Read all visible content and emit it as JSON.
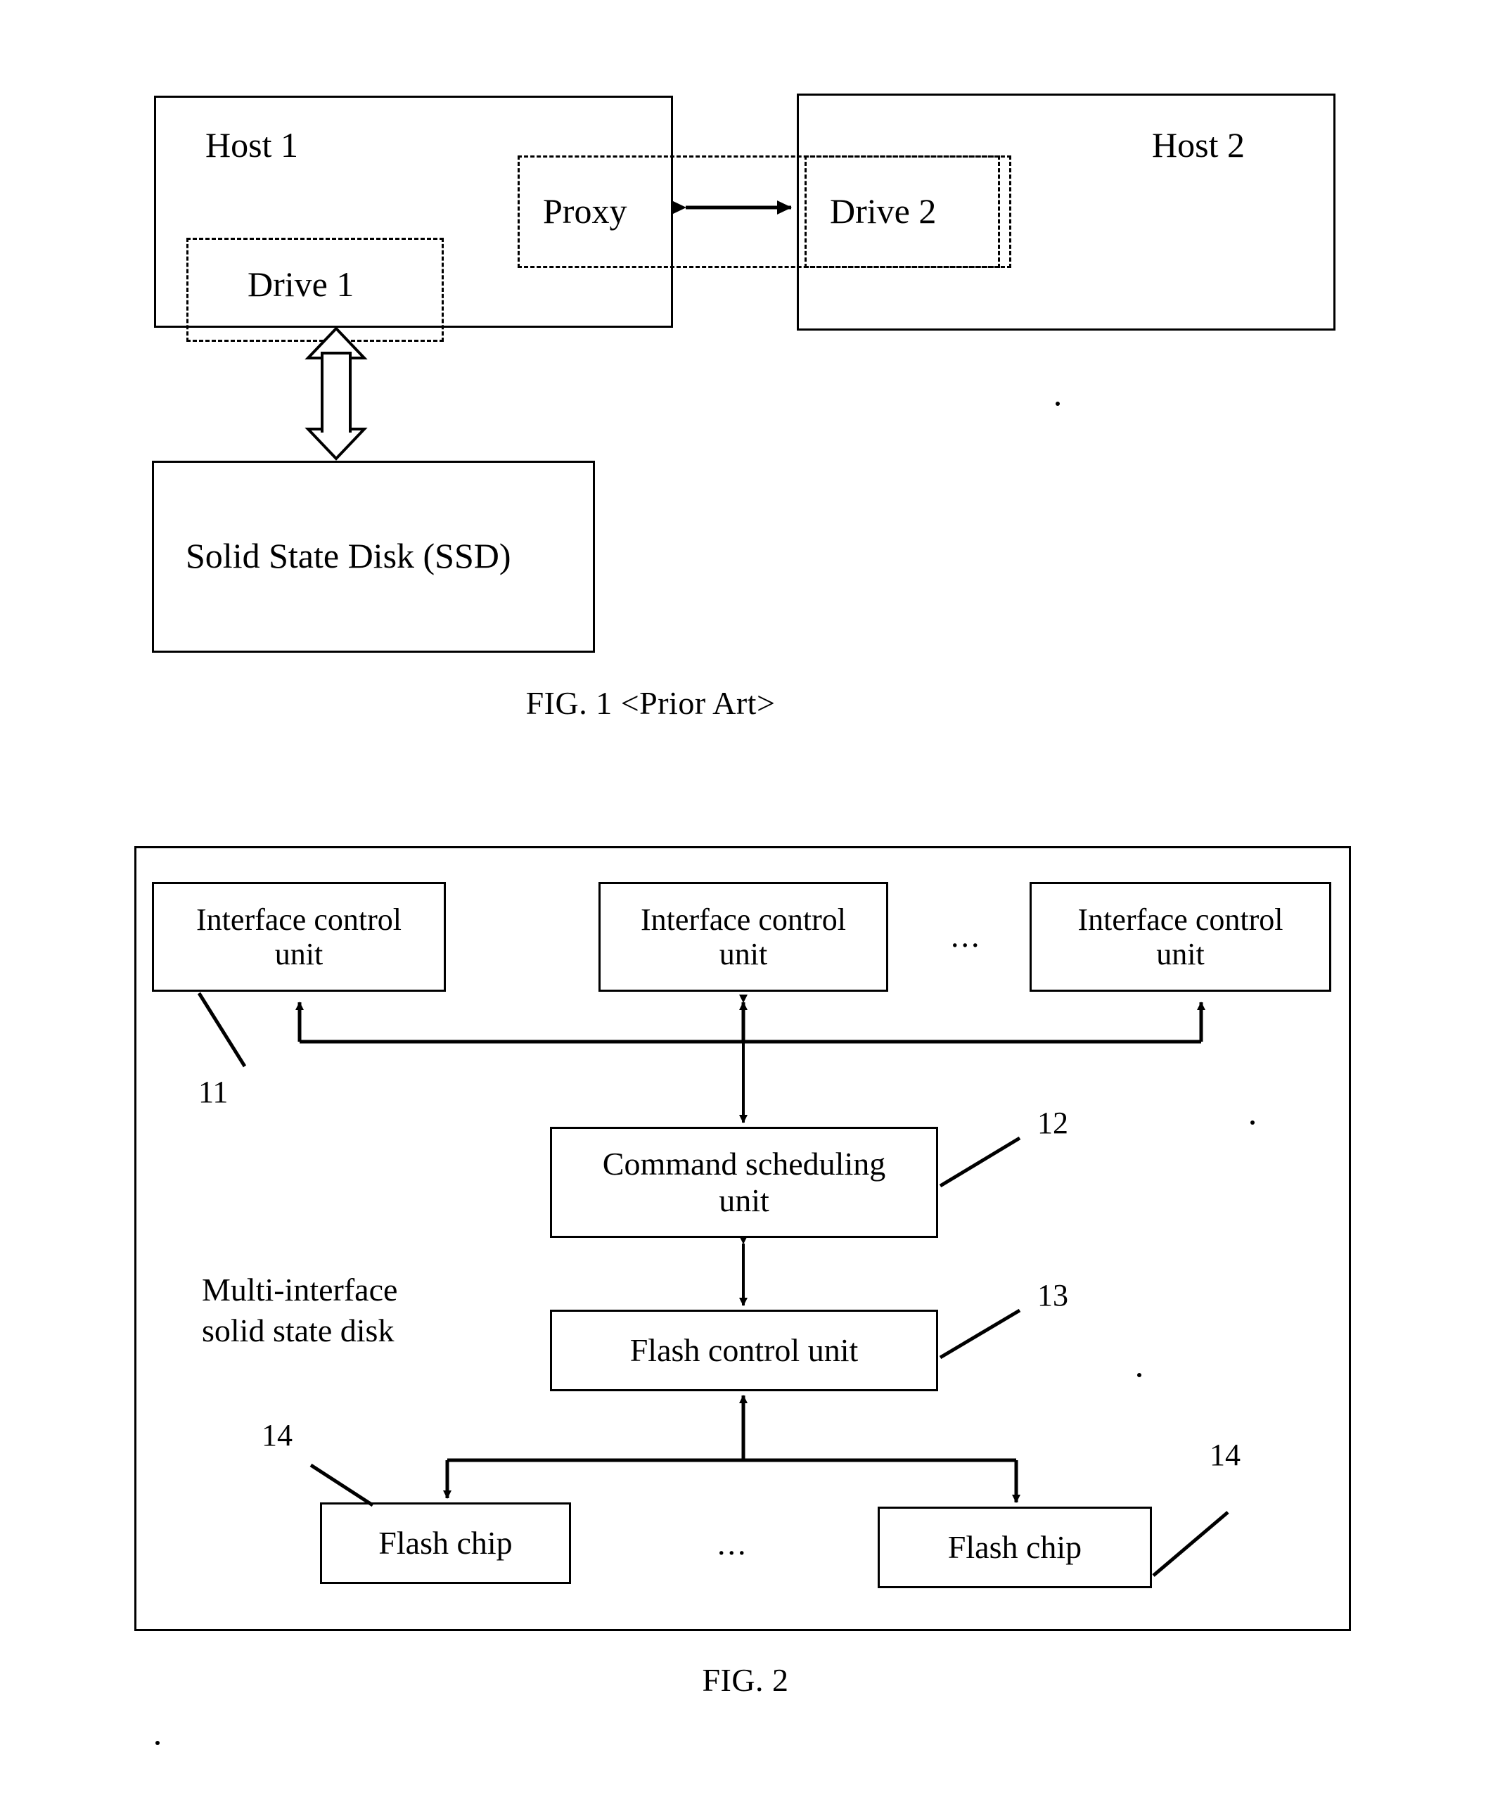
{
  "document": {
    "type": "patent-drawing-sheet",
    "figures": [
      {
        "id": "fig1",
        "caption": "FIG. 1 <Prior Art>",
        "blocks": [
          {
            "name": "host-1",
            "label": "Host 1",
            "style": "solid"
          },
          {
            "name": "proxy",
            "label": "Proxy",
            "style": "dashed"
          },
          {
            "name": "drive-1",
            "label": "Drive 1",
            "style": "dashed"
          },
          {
            "name": "host-2",
            "label": "Host 2",
            "style": "solid"
          },
          {
            "name": "drive-2",
            "label": "Drive 2",
            "style": "dashed"
          },
          {
            "name": "ssd",
            "label": "Solid State Disk (SSD)",
            "style": "solid"
          }
        ],
        "connectors": [
          {
            "name": "proxy-to-drive2",
            "kind": "double-arrow-horizontal"
          },
          {
            "name": "drive1-to-ssd",
            "kind": "hollow-double-arrow-vertical"
          }
        ]
      },
      {
        "id": "fig2",
        "caption": "FIG. 2",
        "container_label": "Multi-interface\nsolid state disk",
        "blocks": [
          {
            "name": "interface-control-unit-1",
            "label": "Interface control\nunit",
            "ref": "11"
          },
          {
            "name": "interface-control-unit-2",
            "label": "Interface control\nunit",
            "ref": ""
          },
          {
            "name": "interface-control-unit-3",
            "label": "Interface control\nunit",
            "ref": ""
          },
          {
            "name": "command-scheduling-unit",
            "label": "Command scheduling\nunit",
            "ref": "12"
          },
          {
            "name": "flash-control-unit",
            "label": "Flash control unit",
            "ref": "13"
          },
          {
            "name": "flash-chip-1",
            "label": "Flash chip",
            "ref": "14"
          },
          {
            "name": "flash-chip-2",
            "label": "Flash chip",
            "ref": "14"
          }
        ],
        "ellipses": [
          {
            "name": "interface-row-ellipsis",
            "text": "..."
          },
          {
            "name": "flash-row-ellipsis",
            "text": "..."
          }
        ],
        "reference_numerals": [
          "11",
          "12",
          "13",
          "14",
          "14"
        ]
      }
    ]
  },
  "colors": {
    "ink": "#000000",
    "paper": "#ffffff"
  }
}
